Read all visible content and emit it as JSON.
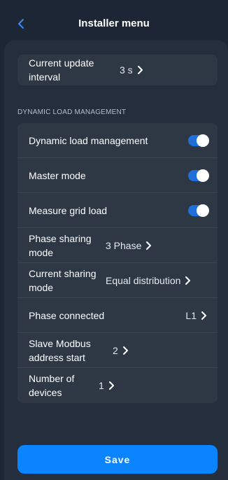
{
  "header": {
    "title": "Installer menu"
  },
  "icons": {
    "back": "chevron-left-icon",
    "chevron": "chevron-right-icon"
  },
  "accent_color": "#0a84ff",
  "update": {
    "label": "Current update interval",
    "value": "3 s"
  },
  "dlm": {
    "section_title": "DYNAMIC LOAD MANAGEMENT",
    "rows": [
      {
        "label": "Dynamic load management",
        "toggle": true
      },
      {
        "label": "Master mode",
        "toggle": true
      },
      {
        "label": "Measure grid load",
        "toggle": true
      },
      {
        "label": "Phase sharing mode",
        "value": "3 Phase"
      },
      {
        "label": "Current sharing mode",
        "value": "Equal distribution"
      },
      {
        "label": "Phase connected",
        "value": "L1"
      },
      {
        "label": "Slave Modbus address start",
        "value": "2"
      },
      {
        "label": "Number of devices",
        "value": "1"
      }
    ]
  },
  "save_label": "Save"
}
